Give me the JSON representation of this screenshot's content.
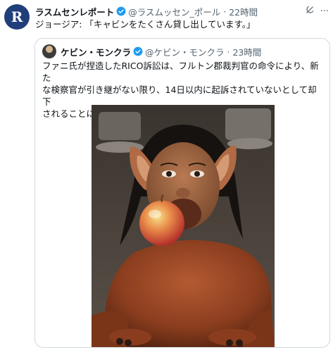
{
  "tweet": {
    "author_name": "ラスムセンレポート",
    "handle": "@ラスムッセン_ポール",
    "time": "22時間",
    "text": "ジョージア: 「キャビンをたくさん貸し出しています。」"
  },
  "quote": {
    "author_name": "ケビン・モンクラ",
    "handle": "@ケビン・モンクラ",
    "time": "23時間",
    "text_lines": [
      "ファニ氏が捏造したRICO訴訟は、フルトン郡裁判官の命令により、新た",
      "な検察官が引き継がない限り、14日以内に起訴されていないとして却下",
      "されることになる。"
    ]
  },
  "icons": {
    "verified": "verified-badge-icon",
    "grok": "grok-icon",
    "more": "more-icon"
  },
  "colors": {
    "verified_blue": "#1d9bf0",
    "text": "#0f1419",
    "muted": "#536471",
    "border": "#cfd9de"
  }
}
